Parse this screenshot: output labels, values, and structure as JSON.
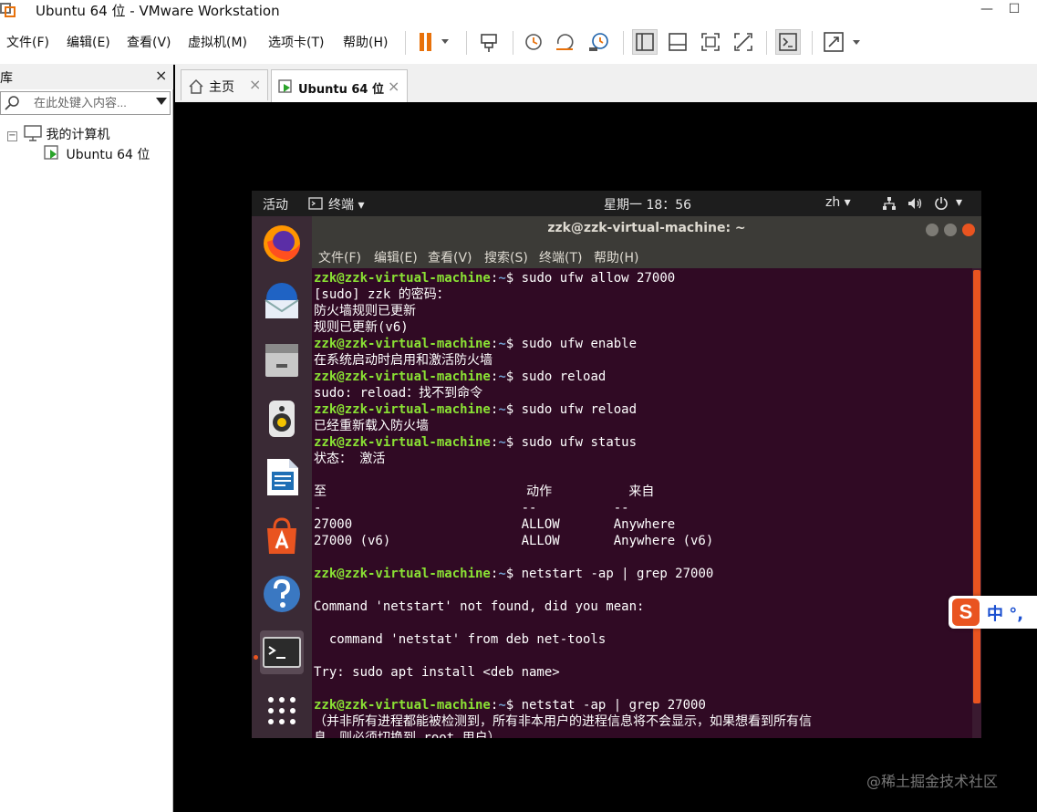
{
  "window": {
    "title": "Ubuntu 64 位 - VMware Workstation",
    "minimize": "—",
    "maximize": "☐"
  },
  "menubar": {
    "items": [
      "文件(F)",
      "编辑(E)",
      "查看(V)",
      "虚拟机(M)",
      "选项卡(T)",
      "帮助(H)"
    ]
  },
  "toolbar": {
    "icons": [
      "pause-icon",
      "send-ctrl-alt-del-icon",
      "snapshot-icon",
      "revert-snapshot-icon",
      "snapshot-manager-icon",
      "normal-view-icon",
      "thumbnail-view-icon",
      "fullscreen-icon",
      "unity-icon",
      "console-icon",
      "stretch-icon"
    ],
    "accent": "#e8710a"
  },
  "sidebar": {
    "title": "库",
    "close": "×",
    "search_placeholder": "在此处键入内容...",
    "tree_expander": "−",
    "tree": [
      {
        "label": "我的计算机",
        "icon": "computer-icon"
      },
      {
        "label": "Ubuntu 64 位",
        "icon": "vm-icon"
      }
    ]
  },
  "tabs": [
    {
      "label": "主页",
      "icon": "home-icon",
      "close": "×"
    },
    {
      "label": "Ubuntu 64 位",
      "icon": "vm-icon",
      "close": "×",
      "active": true
    }
  ],
  "ubuntu": {
    "topbar": {
      "activities": "活动",
      "app_menu": "终端 ▾",
      "clock": "星期一 18：56",
      "lang": "zh ▾",
      "status": "▾"
    },
    "dock": [
      "firefox-icon",
      "thunderbird-icon",
      "files-icon",
      "rhythmbox-icon",
      "libreoffice-writer-icon",
      "software-center-icon",
      "help-icon",
      "terminal-icon",
      "app-grid-icon"
    ],
    "terminal": {
      "title": "zzk@zzk-virtual-machine: ~",
      "menu": [
        "文件(F)",
        "编辑(E)",
        "查看(V)",
        "搜索(S)",
        "终端(T)",
        "帮助(H)"
      ],
      "prompt_user": "zzk@zzk-virtual-machine",
      "prompt_sep": ":",
      "prompt_dir": "~",
      "lines": [
        {
          "type": "cmd",
          "text": "$ sudo ufw allow 27000"
        },
        {
          "type": "out",
          "text": "[sudo] zzk 的密码："
        },
        {
          "type": "out",
          "text": "防火墙规则已更新"
        },
        {
          "type": "out",
          "text": "规则已更新(v6)"
        },
        {
          "type": "cmd",
          "text": "$ sudo ufw enable"
        },
        {
          "type": "out",
          "text": "在系统启动时启用和激活防火墙"
        },
        {
          "type": "cmd",
          "text": "$ sudo reload"
        },
        {
          "type": "out",
          "text": "sudo: reload：找不到命令"
        },
        {
          "type": "cmd",
          "text": "$ sudo ufw reload"
        },
        {
          "type": "out",
          "text": "已经重新载入防火墙"
        },
        {
          "type": "cmd",
          "text": "$ sudo ufw status"
        },
        {
          "type": "out",
          "text": "状态： 激活"
        },
        {
          "type": "out",
          "text": ""
        },
        {
          "type": "out",
          "text": "至                          动作          来自"
        },
        {
          "type": "out",
          "text": "-                          --          --"
        },
        {
          "type": "out",
          "text": "27000                      ALLOW       Anywhere"
        },
        {
          "type": "out",
          "text": "27000 (v6)                 ALLOW       Anywhere (v6)"
        },
        {
          "type": "out",
          "text": ""
        },
        {
          "type": "cmd",
          "text": "$ netstart -ap | grep 27000"
        },
        {
          "type": "out",
          "text": ""
        },
        {
          "type": "out",
          "text": "Command 'netstart' not found, did you mean:"
        },
        {
          "type": "out",
          "text": ""
        },
        {
          "type": "out",
          "text": "  command 'netstat' from deb net-tools"
        },
        {
          "type": "out",
          "text": ""
        },
        {
          "type": "out",
          "text": "Try: sudo apt install <deb name>"
        },
        {
          "type": "out",
          "text": ""
        },
        {
          "type": "cmd",
          "text": "$ netstat -ap | grep 27000"
        },
        {
          "type": "out",
          "text": "（并非所有进程都能被检测到，所有非本用户的进程信息将不会显示，如果想看到所有信"
        },
        {
          "type": "out",
          "text": "息，则必须切换到 root 用户）"
        }
      ]
    }
  },
  "ime": {
    "logo": "S",
    "text": "中 °,"
  },
  "watermark": "@稀土掘金技术社区"
}
